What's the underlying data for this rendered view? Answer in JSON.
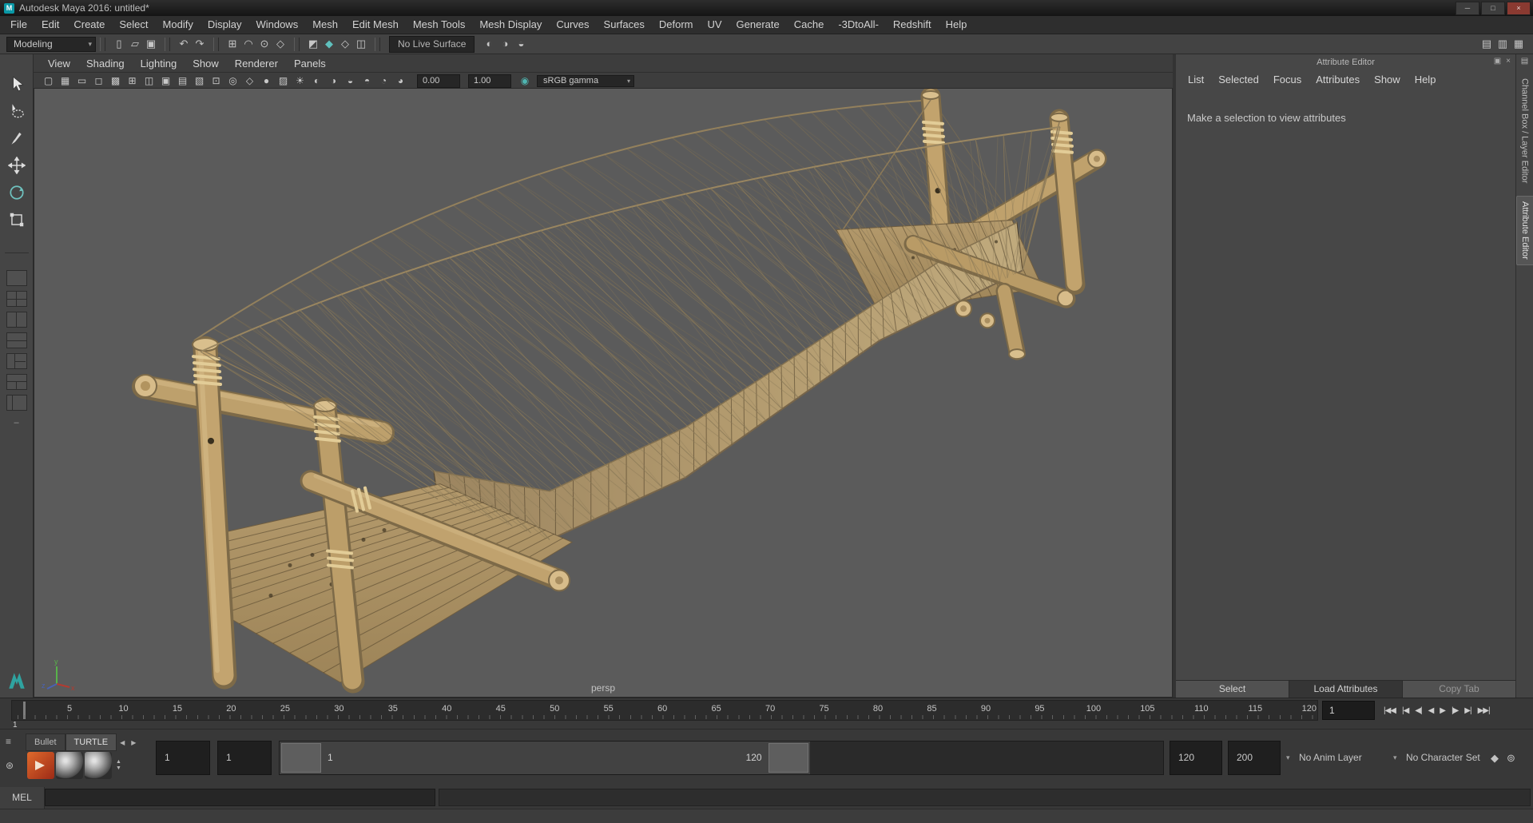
{
  "window": {
    "title": "Autodesk Maya 2016: untitled*",
    "controls": [
      {
        "name": "minimize-button",
        "glyph": "─"
      },
      {
        "name": "maximize-button",
        "glyph": "□"
      },
      {
        "name": "close-button",
        "glyph": "×"
      }
    ]
  },
  "menu_bar": [
    "File",
    "Edit",
    "Create",
    "Select",
    "Modify",
    "Display",
    "Windows",
    "Mesh",
    "Edit Mesh",
    "Mesh Tools",
    "Mesh Display",
    "Curves",
    "Surfaces",
    "Deform",
    "UV",
    "Generate",
    "Cache",
    "-3DtoAll-",
    "Redshift",
    "Help"
  ],
  "status_line": {
    "menu_set": "Modeling",
    "file_icons": [
      {
        "name": "new-scene-icon",
        "glyph": "▯"
      },
      {
        "name": "open-scene-icon",
        "glyph": "▱"
      },
      {
        "name": "save-scene-icon",
        "glyph": "▣"
      }
    ],
    "undo_icons": [
      {
        "name": "undo-icon",
        "glyph": "↶"
      },
      {
        "name": "redo-icon",
        "glyph": "↷"
      }
    ],
    "snap_icons": [
      {
        "name": "snap-to-grid-icon",
        "glyph": "⊞"
      },
      {
        "name": "snap-to-curve-icon",
        "glyph": "◠"
      },
      {
        "name": "snap-to-point-icon",
        "glyph": "⊙"
      },
      {
        "name": "snap-to-plane-icon",
        "glyph": "◇"
      }
    ],
    "selection_icons": [
      {
        "name": "select-hierarchy-icon",
        "glyph": "◩"
      },
      {
        "name": "select-object-icon",
        "glyph": "◆"
      },
      {
        "name": "select-component-icon",
        "glyph": "◇"
      },
      {
        "name": "symmetry-icon",
        "glyph": "◫"
      }
    ],
    "history_icons": [
      {
        "name": "construction-history-icon",
        "glyph": "◐"
      },
      {
        "name": "render-view-icon",
        "glyph": "◑"
      },
      {
        "name": "ipr-render-icon",
        "glyph": "◒"
      }
    ],
    "live_surface": "No Live Surface",
    "right_icons": [
      {
        "name": "toggle-modeling-toolkit-icon",
        "glyph": "▤"
      },
      {
        "name": "toggle-channel-box-icon",
        "glyph": "▥"
      },
      {
        "name": "toggle-attribute-editor-icon",
        "glyph": "▦"
      }
    ]
  },
  "toolbox": {
    "tools": [
      "select-tool",
      "lasso-tool",
      "paint-select-tool",
      "move-tool",
      "rotate-tool",
      "scale-tool"
    ],
    "layouts": [
      "layout-single-pane",
      "layout-four-pane",
      "layout-two-pane-side",
      "layout-two-pane-stacked",
      "layout-three-pane-split-left",
      "layout-three-pane-split-top",
      "layout-outliner-persp"
    ]
  },
  "panel_menu": [
    "View",
    "Shading",
    "Lighting",
    "Show",
    "Renderer",
    "Panels"
  ],
  "panel_toolbar": {
    "icons": [
      {
        "name": "select-camera-icon",
        "glyph": "▢"
      },
      {
        "name": "grid-icon",
        "glyph": "▦"
      },
      {
        "name": "film-gate-icon",
        "glyph": "▭"
      },
      {
        "name": "resolution-gate-icon",
        "glyph": "◻"
      },
      {
        "name": "gate-mask-icon",
        "glyph": "▩"
      },
      {
        "name": "field-chart-icon",
        "glyph": "⊞"
      },
      {
        "name": "safe-action-icon",
        "glyph": "◫"
      },
      {
        "name": "safe-title-icon",
        "glyph": "▣"
      },
      {
        "name": "camera-bookmark-icon",
        "glyph": "▤"
      },
      {
        "name": "image-plane-icon",
        "glyph": "▧"
      },
      {
        "name": "two-d-pan-zoom-icon",
        "glyph": "⊡"
      },
      {
        "name": "isolate-select-icon",
        "glyph": "◎"
      },
      {
        "name": "wireframe-mode-icon",
        "glyph": "◇"
      },
      {
        "name": "shaded-mode-icon",
        "glyph": "●"
      },
      {
        "name": "textured-mode-icon",
        "glyph": "▨"
      },
      {
        "name": "use-all-lights-icon",
        "glyph": "☀"
      },
      {
        "name": "shadows-icon",
        "glyph": "◐"
      },
      {
        "name": "screen-space-ao-icon",
        "glyph": "◑"
      },
      {
        "name": "motion-blur-icon",
        "glyph": "◒"
      },
      {
        "name": "multisample-icon",
        "glyph": "◓"
      },
      {
        "name": "xray-icon",
        "glyph": "◔"
      },
      {
        "name": "exposure-icon",
        "glyph": "◕"
      }
    ],
    "exposure_label": "0.00",
    "gamma_label": "1.00",
    "view_transform": "sRGB gamma"
  },
  "viewport": {
    "camera_label": "persp",
    "scene": "Wooden rope suspension bridge 3D model",
    "background": "#5b5b5b"
  },
  "attribute_editor": {
    "title": "Attribute Editor",
    "header_icons": [
      {
        "name": "undock-icon",
        "glyph": "▣"
      },
      {
        "name": "close-icon",
        "glyph": "×"
      }
    ],
    "menu": [
      "List",
      "Selected",
      "Focus",
      "Attributes",
      "Show",
      "Help"
    ],
    "message": "Make a selection to view attributes",
    "buttons": {
      "select": "Select",
      "load_attributes": "Load Attributes",
      "copy_tab": "Copy Tab"
    }
  },
  "sidebar": {
    "grip_icon": "▤",
    "tabs": [
      "Channel Box / Layer Editor",
      "Attribute Editor"
    ],
    "active": "Attribute Editor"
  },
  "time_slider": {
    "ticks": [
      "5",
      "10",
      "15",
      "20",
      "25",
      "30",
      "35",
      "40",
      "45",
      "50",
      "55",
      "60",
      "65",
      "70",
      "75",
      "80",
      "85",
      "90",
      "95",
      "100",
      "105",
      "110",
      "115",
      "120"
    ],
    "playhead_frame": "1",
    "current_time": "1",
    "transport": [
      {
        "name": "go-to-start-button",
        "glyph": "|◀◀"
      },
      {
        "name": "step-back-key-button",
        "glyph": "|◀"
      },
      {
        "name": "step-back-frame-button",
        "glyph": "◀|"
      },
      {
        "name": "play-backwards-button",
        "glyph": "◀"
      },
      {
        "name": "play-forwards-button",
        "glyph": "▶"
      },
      {
        "name": "step-forward-frame-button",
        "glyph": "|▶"
      },
      {
        "name": "step-forward-key-button",
        "glyph": "▶|"
      },
      {
        "name": "go-to-end-button",
        "glyph": "▶▶|"
      }
    ]
  },
  "range_slider": {
    "animation_start": "1",
    "playback_start": "1",
    "range_label_start": "1",
    "range_label_end": "120",
    "playback_end": "120",
    "animation_end": "200",
    "anim_layer": "No Anim Layer",
    "character_set": "No Character Set",
    "icons": [
      {
        "name": "auto-keyframe-toggle-icon",
        "glyph": "◆"
      },
      {
        "name": "animation-preferences-icon",
        "glyph": "⊚"
      }
    ]
  },
  "shelf": {
    "menu_icons": [
      {
        "name": "shelf-menu-icon",
        "glyph": "≡"
      },
      {
        "name": "shelf-options-icon",
        "glyph": "⊛"
      }
    ],
    "tabs": [
      "Bullet",
      "TURTLE"
    ],
    "active_tab": "TURTLE",
    "nav": [
      {
        "name": "shelf-prev-icon",
        "glyph": "◀"
      },
      {
        "name": "shelf-next-icon",
        "glyph": "▶"
      }
    ],
    "items": [
      "shelf-item-bullet-rocket",
      "shelf-item-material-sphere-1",
      "shelf-item-material-sphere-2"
    ]
  },
  "command_line": {
    "label": "MEL"
  }
}
